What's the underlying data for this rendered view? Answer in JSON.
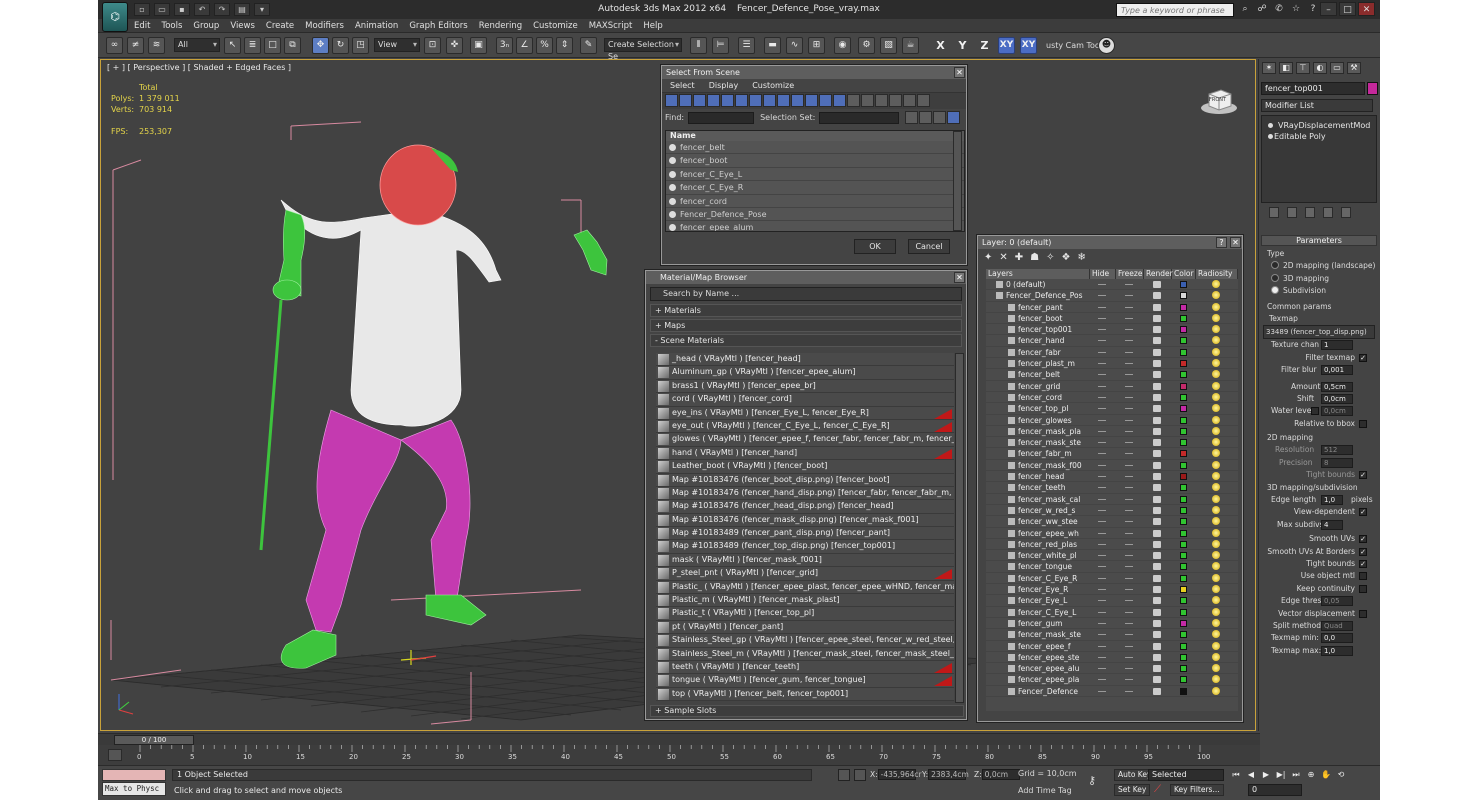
{
  "app": {
    "title_app": "Autodesk 3ds Max  2012 x64",
    "title_file": "Fencer_Defence_Pose_vray.max",
    "logo_glyph": "⌬",
    "search_placeholder": "Type a keyword or phrase"
  },
  "menu": [
    "Edit",
    "Tools",
    "Group",
    "Views",
    "Create",
    "Modifiers",
    "Animation",
    "Graph Editors",
    "Rendering",
    "Customize",
    "MAXScript",
    "Help"
  ],
  "toolbar": {
    "filter_value": "All",
    "refcoord_value": "View",
    "named_sel_placeholder": "Create Selection Se",
    "axis_x": "X",
    "axis_y": "Y",
    "axis_z": "Z",
    "axis_xy": "XY",
    "axis_xy2": "XY",
    "cam_tool": "usty Cam Tool \\"
  },
  "viewport": {
    "label": "[ + ] [ Perspective ] [ Shaded + Edged Faces ]",
    "stats": {
      "total_label": "Total",
      "polys_label": "Polys:",
      "polys_value": "1 379 011",
      "verts_label": "Verts:",
      "verts_value": "703 914",
      "fps_label": "FPS:",
      "fps_value": "253,307"
    },
    "viewcube_label": "FRONT"
  },
  "select_from_scene": {
    "title": "Select From Scene",
    "menu": [
      "Select",
      "Display",
      "Customize"
    ],
    "find_label": "Find:",
    "selection_set_label": "Selection Set:",
    "column_name": "Name",
    "rows": [
      "fencer_belt",
      "fencer_boot",
      "fencer_C_Eye_L",
      "fencer_C_Eye_R",
      "fencer_cord",
      "Fencer_Defence_Pose",
      "fencer_epee_alum"
    ],
    "ok": "OK",
    "cancel": "Cancel"
  },
  "material_browser": {
    "title": "Material/Map Browser",
    "search_placeholder": "Search by Name ...",
    "group_materials": "+ Materials",
    "group_maps": "+ Maps",
    "group_scene": "- Scene Materials",
    "group_sample": "+ Sample Slots",
    "rows": [
      {
        "text": "_head  ( VRayMtl ) [fencer_head]",
        "flag": false
      },
      {
        "text": "Aluminum_gp  ( VRayMtl ) [fencer_epee_alum]",
        "flag": false
      },
      {
        "text": "brass1  ( VRayMtl ) [fencer_epee_br]",
        "flag": false
      },
      {
        "text": "cord  ( VRayMtl ) [fencer_cord]",
        "flag": false
      },
      {
        "text": "eye_ins  ( VRayMtl ) [fencer_Eye_L, fencer_Eye_R]",
        "flag": true
      },
      {
        "text": "eye_out  ( VRayMtl ) [fencer_C_Eye_L, fencer_C_Eye_R]",
        "flag": true
      },
      {
        "text": "glowes  ( VRayMtl ) [fencer_epee_f, fencer_fabr, fencer_fabr_m, fencer_glowes]",
        "flag": false
      },
      {
        "text": "hand  ( VRayMtl ) [fencer_hand]",
        "flag": true
      },
      {
        "text": "Leather_boot  ( VRayMtl ) [fencer_boot]",
        "flag": false
      },
      {
        "text": "Map #10183476 (fencer_boot_disp.png)  [fencer_boot]",
        "flag": false
      },
      {
        "text": "Map #10183476 (fencer_hand_disp.png)  [fencer_fabr, fencer_fabr_m, fencer_gl...",
        "flag": false
      },
      {
        "text": "Map #10183476 (fencer_head_disp.png)  [fencer_head]",
        "flag": false
      },
      {
        "text": "Map #10183476 (fencer_mask_disp.png)  [fencer_mask_f001]",
        "flag": false
      },
      {
        "text": "Map #10183489 (fencer_pant_disp.png)  [fencer_pant]",
        "flag": false
      },
      {
        "text": "Map #10183489 (fencer_top_disp.png)  [fencer_top001]",
        "flag": false
      },
      {
        "text": "mask  ( VRayMtl ) [fencer_mask_f001]",
        "flag": false
      },
      {
        "text": "P_steel_pnt  ( VRayMtl ) [fencer_grid]",
        "flag": true
      },
      {
        "text": "Plastic_  ( VRayMtl ) [fencer_epee_plast, fencer_epee_wHND, fencer_mask_cabl...",
        "flag": false
      },
      {
        "text": "Plastic_m  ( VRayMtl ) [fencer_mask_plast]",
        "flag": false
      },
      {
        "text": "Plastic_t  ( VRayMtl ) [fencer_top_pl]",
        "flag": false
      },
      {
        "text": "pt  ( VRayMtl ) [fencer_pant]",
        "flag": false
      },
      {
        "text": "Stainless_Steel_gp  ( VRayMtl ) [fencer_epee_steel, fencer_w_red_steel, fencer_...",
        "flag": false
      },
      {
        "text": "Stainless_Steel_m  ( VRayMtl ) [fencer_mask_steel, fencer_mask_steel_C]",
        "flag": false
      },
      {
        "text": "teeth  ( VRayMtl ) [fencer_teeth]",
        "flag": true
      },
      {
        "text": "tongue  ( VRayMtl ) [fencer_gum, fencer_tongue]",
        "flag": true
      },
      {
        "text": "top  ( VRayMtl ) [fencer_belt, fencer_top001]",
        "flag": false
      }
    ]
  },
  "layer_dialog": {
    "title": "Layer: 0 (default)",
    "columns": [
      "Layers",
      "Hide",
      "Freeze",
      "Render",
      "Color",
      "Radiosity"
    ],
    "rows": [
      {
        "name": "0 (default)",
        "type": "root",
        "color": "#3a5fb0"
      },
      {
        "name": "Fencer_Defence_Pos",
        "type": "grp",
        "color": "#d8d8d8"
      },
      {
        "name": "fencer_pant",
        "type": "item",
        "color": "#c42aa6"
      },
      {
        "name": "fencer_boot",
        "type": "item",
        "color": "#31c431"
      },
      {
        "name": "fencer_top001",
        "type": "item",
        "color": "#c42aa6"
      },
      {
        "name": "fencer_hand",
        "type": "item",
        "color": "#31c431"
      },
      {
        "name": "fencer_fabr",
        "type": "item",
        "color": "#31c431"
      },
      {
        "name": "fencer_plast_m",
        "type": "item",
        "color": "#c42a2a"
      },
      {
        "name": "fencer_belt",
        "type": "item",
        "color": "#31c431"
      },
      {
        "name": "fencer_grid",
        "type": "item",
        "color": "#c42a6a"
      },
      {
        "name": "fencer_cord",
        "type": "item",
        "color": "#31c431"
      },
      {
        "name": "fencer_top_pl",
        "type": "item",
        "color": "#c42aa6"
      },
      {
        "name": "fencer_glowes",
        "type": "item",
        "color": "#31c431"
      },
      {
        "name": "fencer_mask_pla",
        "type": "item",
        "color": "#31c431"
      },
      {
        "name": "fencer_mask_ste",
        "type": "item",
        "color": "#31c431"
      },
      {
        "name": "fencer_fabr_m",
        "type": "item",
        "color": "#c42a2a"
      },
      {
        "name": "fencer_mask_f00",
        "type": "item",
        "color": "#31c431"
      },
      {
        "name": "fencer_head",
        "type": "item",
        "color": "#9a1a1a"
      },
      {
        "name": "fencer_teeth",
        "type": "item",
        "color": "#31c431"
      },
      {
        "name": "fencer_mask_cal",
        "type": "item",
        "color": "#31c431"
      },
      {
        "name": "fencer_w_red_s",
        "type": "item",
        "color": "#31c431"
      },
      {
        "name": "fencer_ww_stee",
        "type": "item",
        "color": "#31c431"
      },
      {
        "name": "fencer_epee_wh",
        "type": "item",
        "color": "#31c431"
      },
      {
        "name": "fencer_red_plas",
        "type": "item",
        "color": "#31c431"
      },
      {
        "name": "fencer_white_pl",
        "type": "item",
        "color": "#31c431"
      },
      {
        "name": "fencer_tongue",
        "type": "item",
        "color": "#31c431"
      },
      {
        "name": "fencer_C_Eye_R",
        "type": "item",
        "color": "#31c431"
      },
      {
        "name": "fencer_Eye_R",
        "type": "item",
        "color": "#e8d020"
      },
      {
        "name": "fencer_Eye_L",
        "type": "item",
        "color": "#31c431"
      },
      {
        "name": "fencer_C_Eye_L",
        "type": "item",
        "color": "#31c431"
      },
      {
        "name": "fencer_gum",
        "type": "item",
        "color": "#c42aa6"
      },
      {
        "name": "fencer_mask_ste",
        "type": "item",
        "color": "#31c431"
      },
      {
        "name": "fencer_epee_f",
        "type": "item",
        "color": "#31c431"
      },
      {
        "name": "fencer_epee_ste",
        "type": "item",
        "color": "#31c431"
      },
      {
        "name": "fencer_epee_alu",
        "type": "item",
        "color": "#31c431"
      },
      {
        "name": "fencer_epee_pla",
        "type": "item",
        "color": "#31c431"
      },
      {
        "name": "Fencer_Defence",
        "type": "item",
        "color": "#111111"
      }
    ]
  },
  "command_panel": {
    "object_name": "fencer_top001",
    "modifier_list": "Modifier List",
    "stack": [
      "VRayDisplacementMod",
      "Editable Poly"
    ],
    "parameters_title": "Parameters",
    "type_label": "Type",
    "type_2d": "2D mapping (landscape)",
    "type_3d": "3D mapping",
    "type_subdiv": "Subdivision",
    "common_params": "Common params",
    "texmap_label": "Texmap",
    "texmap_value": "33489 (fencer_top_disp.png)",
    "texture_chan_label": "Texture chan",
    "texture_chan_value": "1",
    "filter_texmap_label": "Filter texmap",
    "filter_blur_label": "Filter blur",
    "filter_blur_value": "0,001",
    "amount_label": "Amount",
    "amount_value": "0,5cm",
    "shift_label": "Shift",
    "shift_value": "0,0cm",
    "water_level_label": "Water level",
    "water_level_value": "0,0cm",
    "relative_bbox_label": "Relative to bbox",
    "mapping_2d_title": "2D mapping",
    "resolution_label": "Resolution",
    "resolution_value": "512",
    "precision_label": "Precision",
    "precision_value": "8",
    "tight_bounds_label": "Tight bounds",
    "mapping_3d_title": "3D mapping/subdivision",
    "edge_length_label": "Edge length",
    "edge_length_value": "1,0",
    "pixels_label": "pixels",
    "view_dependent_label": "View-dependent",
    "max_subdivs_label": "Max subdivs",
    "max_subdivs_value": "4",
    "smooth_uvs_label": "Smooth UVs",
    "smooth_uvs_borders_label": "Smooth UVs At Borders",
    "tight_bounds2_label": "Tight bounds",
    "use_object_mtl_label": "Use object mtl",
    "keep_continuity_label": "Keep continuity",
    "edge_thresh_label": "Edge thresh",
    "edge_thresh_value": "0,05",
    "vector_disp_label": "Vector displacement",
    "split_method_label": "Split method",
    "split_method_value": "Quad",
    "texmap_min_label": "Texmap min:",
    "texmap_min_value": "0,0",
    "texmap_max_label": "Texmap max:",
    "texmap_max_value": "1,0"
  },
  "timeline": {
    "slider_label": "0 / 100",
    "ticks": [
      "0",
      "5",
      "10",
      "15",
      "20",
      "25",
      "30",
      "35",
      "40",
      "45",
      "50",
      "55",
      "60",
      "65",
      "70",
      "75",
      "80",
      "85",
      "90",
      "95",
      "100"
    ]
  },
  "status": {
    "maxscript": "Max to Physc",
    "selection": "1 Object Selected",
    "prompt": "Click and drag to select and move objects",
    "x_label": "X:",
    "x_value": "-435,964cr",
    "y_label": "Y:",
    "y_value": "2383,4cm",
    "z_label": "Z:",
    "z_value": "0,0cm",
    "grid": "Grid = 10,0cm",
    "add_time_tag": "Add Time Tag",
    "auto_key": "Auto Key",
    "set_key": "Set Key",
    "selected": "Selected",
    "key_filters": "Key Filters...",
    "frame": "0"
  }
}
